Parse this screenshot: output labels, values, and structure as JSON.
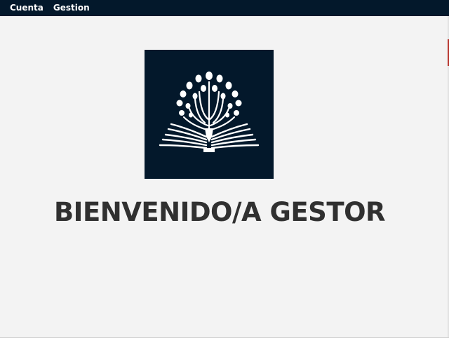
{
  "menubar": {
    "items": [
      {
        "label": "Cuenta"
      },
      {
        "label": "Gestion"
      }
    ]
  },
  "logo": {
    "icon": "tree-book-logo-icon"
  },
  "main": {
    "welcome": "BIENVENIDO/A GESTOR"
  },
  "colors": {
    "menubar_bg": "#03182b",
    "logo_bg": "#03182b",
    "window_bg": "#f3f3f3",
    "title_text": "#303030"
  }
}
